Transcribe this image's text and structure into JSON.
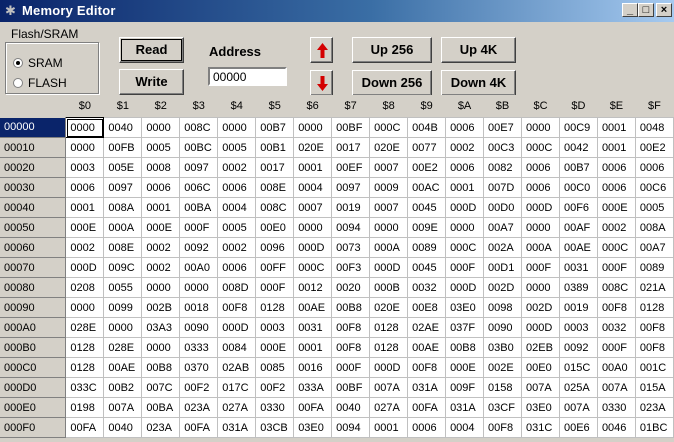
{
  "window": {
    "title": "Memory Editor",
    "controls": {
      "minimize": "_",
      "maximize": "□",
      "close": "×"
    }
  },
  "memory_group": {
    "legend": "Flash/SRAM",
    "options": [
      {
        "label": "SRAM",
        "selected": true
      },
      {
        "label": "FLASH",
        "selected": false
      }
    ]
  },
  "buttons": {
    "read": "Read",
    "write": "Write",
    "up256": "Up 256",
    "up4k": "Up 4K",
    "down256": "Down 256",
    "down4k": "Down 4K"
  },
  "address": {
    "label": "Address",
    "value": "00000"
  },
  "colors": {
    "arrow_red": "#d40000",
    "selection_navy": "#0a246a"
  },
  "grid": {
    "column_headers": [
      "$0",
      "$1",
      "$2",
      "$3",
      "$4",
      "$5",
      "$6",
      "$7",
      "$8",
      "$9",
      "$A",
      "$B",
      "$C",
      "$D",
      "$E",
      "$F"
    ],
    "selected_row": 0,
    "selected_col": 0,
    "rows": [
      {
        "address": "00000",
        "values": [
          "0000",
          "0040",
          "0000",
          "008C",
          "0000",
          "00B7",
          "0000",
          "00BF",
          "000C",
          "004B",
          "0006",
          "00E7",
          "0000",
          "00C9",
          "0001",
          "0048"
        ]
      },
      {
        "address": "00010",
        "values": [
          "0000",
          "00FB",
          "0005",
          "00BC",
          "0005",
          "00B1",
          "020E",
          "0017",
          "020E",
          "0077",
          "0002",
          "00C3",
          "000C",
          "0042",
          "0001",
          "00E2"
        ]
      },
      {
        "address": "00020",
        "values": [
          "0003",
          "005E",
          "0008",
          "0097",
          "0002",
          "0017",
          "0001",
          "00EF",
          "0007",
          "00E2",
          "0006",
          "0082",
          "0006",
          "00B7",
          "0006",
          "0006"
        ]
      },
      {
        "address": "00030",
        "values": [
          "0006",
          "0097",
          "0006",
          "006C",
          "0006",
          "008E",
          "0004",
          "0097",
          "0009",
          "00AC",
          "0001",
          "007D",
          "0006",
          "00C0",
          "0006",
          "00C6"
        ]
      },
      {
        "address": "00040",
        "values": [
          "0001",
          "008A",
          "0001",
          "00BA",
          "0004",
          "008C",
          "0007",
          "0019",
          "0007",
          "0045",
          "000D",
          "00D0",
          "000D",
          "00F6",
          "000E",
          "0005"
        ]
      },
      {
        "address": "00050",
        "values": [
          "000E",
          "000A",
          "000E",
          "000F",
          "0005",
          "00E0",
          "0000",
          "0094",
          "0000",
          "009E",
          "0000",
          "00A7",
          "0000",
          "00AF",
          "0002",
          "008A"
        ]
      },
      {
        "address": "00060",
        "values": [
          "0002",
          "008E",
          "0002",
          "0092",
          "0002",
          "0096",
          "000D",
          "0073",
          "000A",
          "0089",
          "000C",
          "002A",
          "000A",
          "00AE",
          "000C",
          "00A7"
        ]
      },
      {
        "address": "00070",
        "values": [
          "000D",
          "009C",
          "0002",
          "00A0",
          "0006",
          "00FF",
          "000C",
          "00F3",
          "000D",
          "0045",
          "000F",
          "00D1",
          "000F",
          "0031",
          "000F",
          "0089"
        ]
      },
      {
        "address": "00080",
        "values": [
          "0208",
          "0055",
          "0000",
          "0000",
          "008D",
          "000F",
          "0012",
          "0020",
          "000B",
          "0032",
          "000D",
          "002D",
          "0000",
          "0389",
          "008C",
          "021A"
        ]
      },
      {
        "address": "00090",
        "values": [
          "0000",
          "0099",
          "002B",
          "0018",
          "00F8",
          "0128",
          "00AE",
          "00B8",
          "020E",
          "00E8",
          "03E0",
          "0098",
          "002D",
          "0019",
          "00F8",
          "0128"
        ]
      },
      {
        "address": "000A0",
        "values": [
          "028E",
          "0000",
          "03A3",
          "0090",
          "000D",
          "0003",
          "0031",
          "00F8",
          "0128",
          "02AE",
          "037F",
          "0090",
          "000D",
          "0003",
          "0032",
          "00F8"
        ]
      },
      {
        "address": "000B0",
        "values": [
          "0128",
          "028E",
          "0000",
          "0333",
          "0084",
          "000E",
          "0001",
          "00F8",
          "0128",
          "00AE",
          "00B8",
          "03B0",
          "02EB",
          "0092",
          "000F",
          "00F8"
        ]
      },
      {
        "address": "000C0",
        "values": [
          "0128",
          "00AE",
          "00B8",
          "0370",
          "02AB",
          "0085",
          "0016",
          "000F",
          "000D",
          "00F8",
          "000E",
          "002E",
          "00E0",
          "015C",
          "00A0",
          "001C"
        ]
      },
      {
        "address": "000D0",
        "values": [
          "033C",
          "00B2",
          "007C",
          "00F2",
          "017C",
          "00F2",
          "033A",
          "00BF",
          "007A",
          "031A",
          "009F",
          "0158",
          "007A",
          "025A",
          "007A",
          "015A"
        ]
      },
      {
        "address": "000E0",
        "values": [
          "0198",
          "007A",
          "00BA",
          "023A",
          "027A",
          "0330",
          "00FA",
          "0040",
          "027A",
          "00FA",
          "031A",
          "03CF",
          "03E0",
          "007A",
          "0330",
          "023A"
        ]
      },
      {
        "address": "000F0",
        "values": [
          "00FA",
          "0040",
          "023A",
          "00FA",
          "031A",
          "03CB",
          "03E0",
          "0094",
          "0001",
          "0006",
          "0004",
          "00F8",
          "031C",
          "00E6",
          "0046",
          "01BC"
        ]
      }
    ]
  }
}
